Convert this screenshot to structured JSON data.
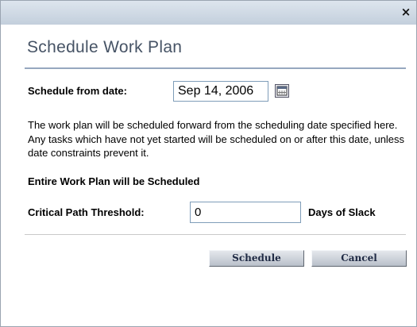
{
  "titlebar": {
    "close_glyph": "×"
  },
  "dialog": {
    "title": "Schedule Work Plan",
    "schedule_from_label": "Schedule from date:",
    "schedule_from_value": "Sep 14, 2006",
    "description": "The work plan will be scheduled forward from the scheduling date specified here. Any tasks which have not yet started will be scheduled on or after this date, unless date constraints prevent it.",
    "entire_plan_label": "Entire Work Plan will be Scheduled",
    "critical_path_label": "Critical Path Threshold:",
    "critical_path_value": "0",
    "days_of_slack_label": "Days of Slack"
  },
  "buttons": {
    "schedule_label": "Schedule",
    "cancel_label": "Cancel"
  },
  "icons": {
    "calendar": "calendar-icon",
    "close": "close-icon"
  }
}
